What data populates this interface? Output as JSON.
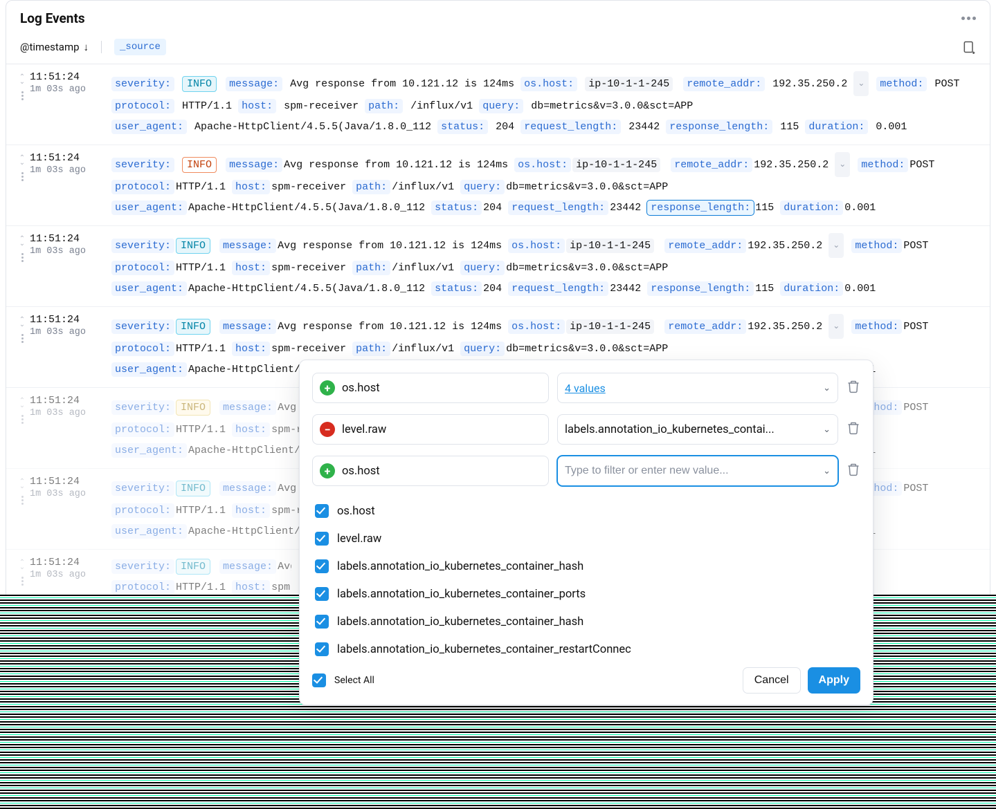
{
  "header": {
    "title": "Log Events",
    "timestamp_col": "@timestamp",
    "source_chip": "_source"
  },
  "log": {
    "severity_label": "severity:",
    "message_label": "message:",
    "message_value": "Avg response from 10.121.12 is 124ms",
    "os_host_label": "os.host:",
    "os_host_value": "ip-10-1-1-245",
    "remote_addr_label": "remote_addr:",
    "remote_addr_value": "192.35.250.2",
    "method_label": "method:",
    "method_value": "POST",
    "protocol_label": "protocol:",
    "protocol_value": "HTTP/1.1",
    "host_label": "host:",
    "host_value": "spm-receiver",
    "path_label": "path:",
    "path_value": "/influx/v1",
    "query_label": "query:",
    "query_value": "db=metrics&v=3.0.0&sct=APP",
    "user_agent_label": "user_agent:",
    "user_agent_value": "Apache-HttpClient/4.5.5(Java/1.8.0_112",
    "status_label": "status:",
    "status_value": "204",
    "request_length_label": "request_length:",
    "request_length_value": "23442",
    "response_length_label": "response_length:",
    "response_length_value": "115",
    "duration_label": "duration:",
    "duration_value": "0.001",
    "info_text": "INFO",
    "time": "11:51:24",
    "rel": "1m 03s ago"
  },
  "panel": {
    "field_os_host": "os.host",
    "field_level_raw": "level.raw",
    "four_values": "4 values",
    "labels_truncated": "labels.annotation_io_kubernetes_contai...",
    "placeholder": "Type to filter or enter new value...",
    "checks": [
      "os.host",
      "level.raw",
      "labels.annotation_io_kubernetes_container_hash",
      "labels.annotation_io_kubernetes_container_ports",
      "labels.annotation_io_kubernetes_container_hash",
      "labels.annotation_io_kubernetes_container_restartConnec"
    ],
    "select_all": "Select All",
    "cancel": "Cancel",
    "apply": "Apply"
  }
}
